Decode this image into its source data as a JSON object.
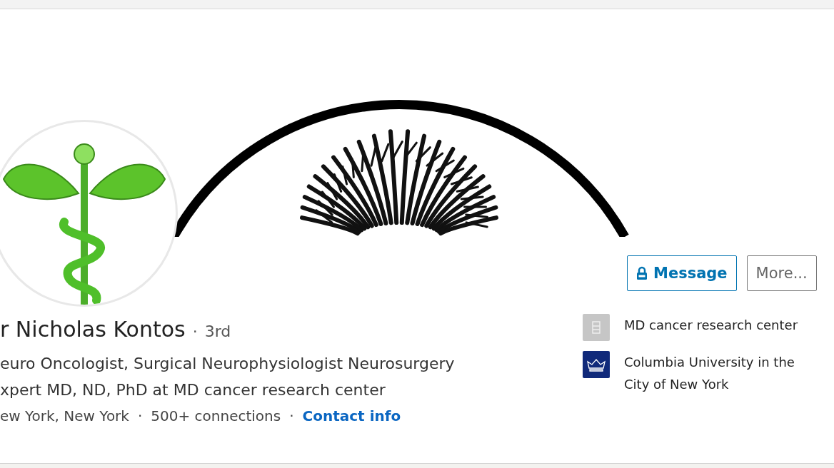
{
  "profile": {
    "name": "r Nicholas Kontos",
    "degree": "3rd",
    "headline_lines": [
      "euro Oncologist, Surgical Neurophysiologist Neurosurgery",
      "xpert MD, ND, PhD at MD cancer research center"
    ],
    "location": "ew York, New York",
    "connections": "500+ connections",
    "contact_link": "Contact info",
    "separator": "·"
  },
  "actions": [
    {
      "label": "Message",
      "kind": "locked"
    },
    {
      "label": "More...",
      "kind": "plain"
    }
  ],
  "affiliations": [
    {
      "name": "MD cancer research center",
      "kind": "company"
    },
    {
      "name": "Columbia University in the City of New York",
      "kind": "school"
    }
  ]
}
